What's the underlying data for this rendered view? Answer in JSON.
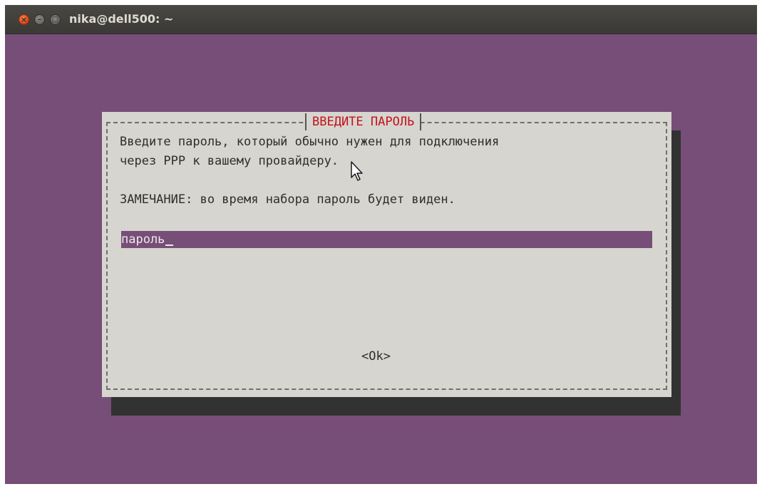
{
  "window": {
    "title": "nika@dell500: ~",
    "buttons": {
      "close_icon": "close-icon",
      "minimize_icon": "minimize-icon",
      "maximize_icon": "maximize-icon"
    }
  },
  "dialog": {
    "title": "ВВЕДИТЕ ПАРОЛЬ",
    "message_line1": "Введите пароль, который обычно нужен для подключения",
    "message_line2": "через PPP к вашему провайдеру.",
    "note": "ЗАМЕЧАНИЕ: во время набора пароль будет виден.",
    "input_value": "пароль",
    "ok_label": "<Ok>"
  },
  "colors": {
    "terminal_background": "#764e77",
    "dialog_background": "#d6d5cf",
    "dialog_title": "#c4121a",
    "dialog_shadow": "#323232",
    "input_background": "#764e77"
  }
}
